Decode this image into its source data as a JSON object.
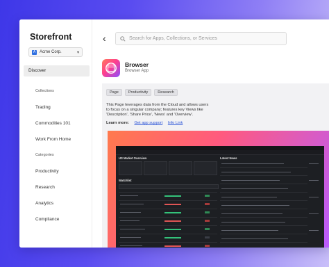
{
  "sidebar": {
    "brand": "Storefront",
    "workspace": "Acme Corp.",
    "workspace_initial": "A",
    "active_item": "Discover",
    "sections": [
      {
        "title": "Collections",
        "items": [
          "Trading",
          "Commodities 101",
          "Work From Home"
        ]
      },
      {
        "title": "Categories",
        "items": [
          "Productivity",
          "Research",
          "Analytics",
          "Compliance"
        ]
      }
    ]
  },
  "search": {
    "placeholder": "Search for Apps, Collections, or Services"
  },
  "app": {
    "title": "Browser",
    "subtitle": "Browser App",
    "tags": [
      "Page",
      "Productivity",
      "Research"
    ],
    "description": "This Page leverages data from the Cloud and allows users to focus on a singular company; features key Views like 'Description', 'Share Price', 'News' and 'Overview'.",
    "learn_more_label": "Learn more:",
    "links": [
      "Get app support",
      "Info Link"
    ]
  },
  "preview": {
    "left_title": "US Market Overview",
    "watchlist_title": "Watchlist",
    "news_title": "Latest News"
  },
  "colors": {
    "accent": "#3e37e8",
    "link": "#2d55d8",
    "preview_gradient_start": "#ff7a4d",
    "preview_gradient_end": "#b85cff"
  }
}
